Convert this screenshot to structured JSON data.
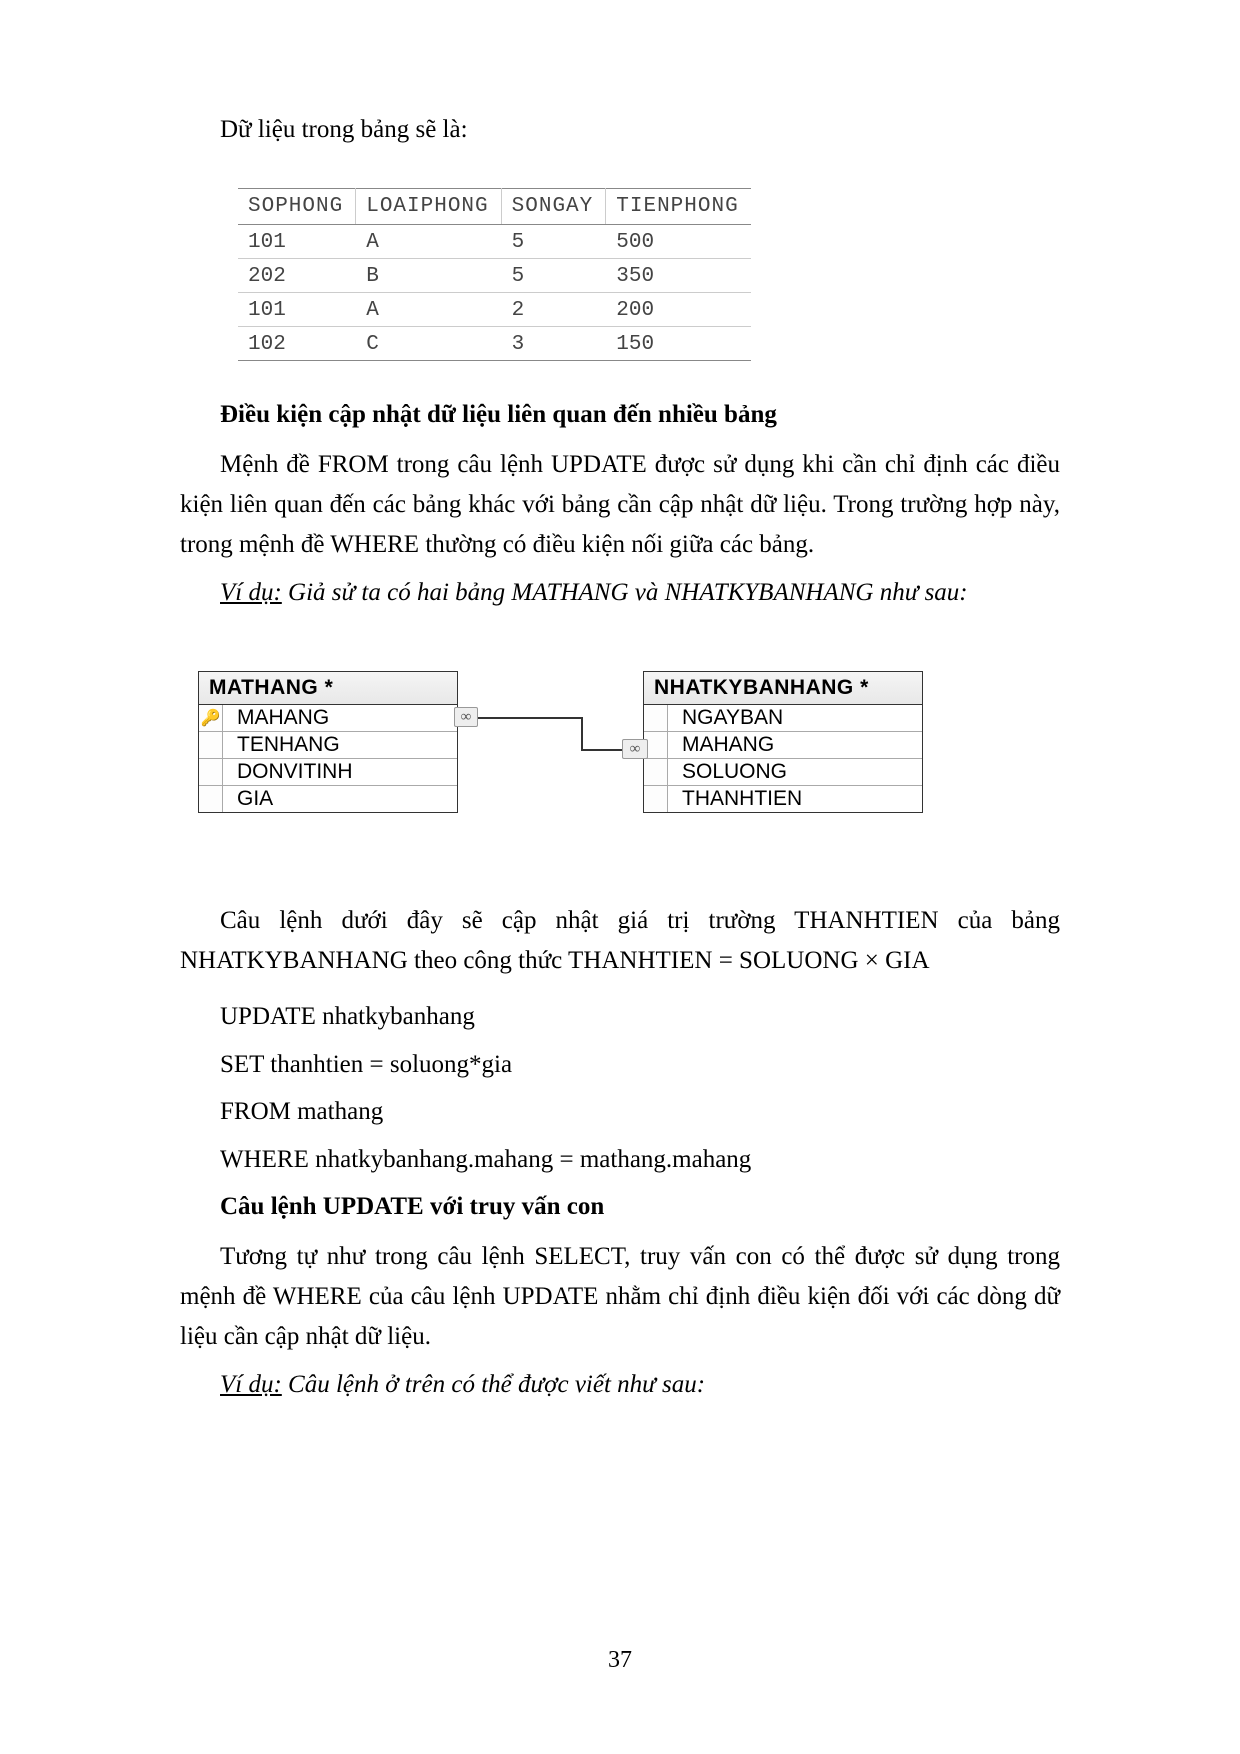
{
  "intro": "Dữ liệu trong bảng sẽ là:",
  "table": {
    "headers": [
      "SOPHONG",
      "LOAIPHONG",
      "SONGAY",
      "TIENPHONG"
    ],
    "rows": [
      [
        "101",
        "A",
        "5",
        "500"
      ],
      [
        "202",
        "B",
        "5",
        "350"
      ],
      [
        "101",
        "A",
        "2",
        "200"
      ],
      [
        "102",
        "C",
        "3",
        "150"
      ]
    ]
  },
  "heading1": "Điều kiện cập nhật dữ liệu liên quan đến nhiều bảng",
  "para1": "Mệnh đề FROM trong câu lệnh UPDATE được sử dụng khi cần chỉ định các điều kiện liên quan đến các bảng khác với bảng cần cập nhật dữ liệu. Trong trường hợp này, trong mệnh đề WHERE thường có điều kiện nối giữa các bảng.",
  "example_label": "Ví dụ:",
  "example1": " Giả sử ta có hai bảng MATHANG và NHATKYBANHANG như sau:",
  "schema": {
    "left": {
      "title": "MATHANG *",
      "fields": [
        "MAHANG",
        "TENHANG",
        "DONVITINH",
        "GIA"
      ],
      "key_index": 0
    },
    "right": {
      "title": "NHATKYBANHANG *",
      "fields": [
        "NGAYBAN",
        "MAHANG",
        "SOLUONG",
        "THANHTIEN"
      ],
      "key_index": -1
    },
    "left_conn": "∞",
    "right_conn": "∞"
  },
  "para2": "Câu lệnh dưới đây sẽ  cập nhật giá trị trường THANHTIEN của bảng NHATKYBANHANG theo công thức THANHTIEN = SOLUONG × GIA",
  "sql": {
    "l1": "UPDATE nhatkybanhang",
    "l2": "SET  thanhtien = soluong*gia",
    "l3": "FROM mathang",
    "l4": "WHERE nhatkybanhang.mahang = mathang.mahang"
  },
  "heading2": "Câu lệnh UPDATE với truy vấn con",
  "para3": "Tương tự như trong câu lệnh SELECT, truy vấn con có thể được sử dụng trong mệnh đề WHERE của câu lệnh UPDATE nhằm chỉ định điều kiện đối với các dòng dữ liệu cần cập nhật dữ liệu.",
  "example2": " Câu lệnh ở trên có thể được viết như sau:",
  "page_number": "37"
}
